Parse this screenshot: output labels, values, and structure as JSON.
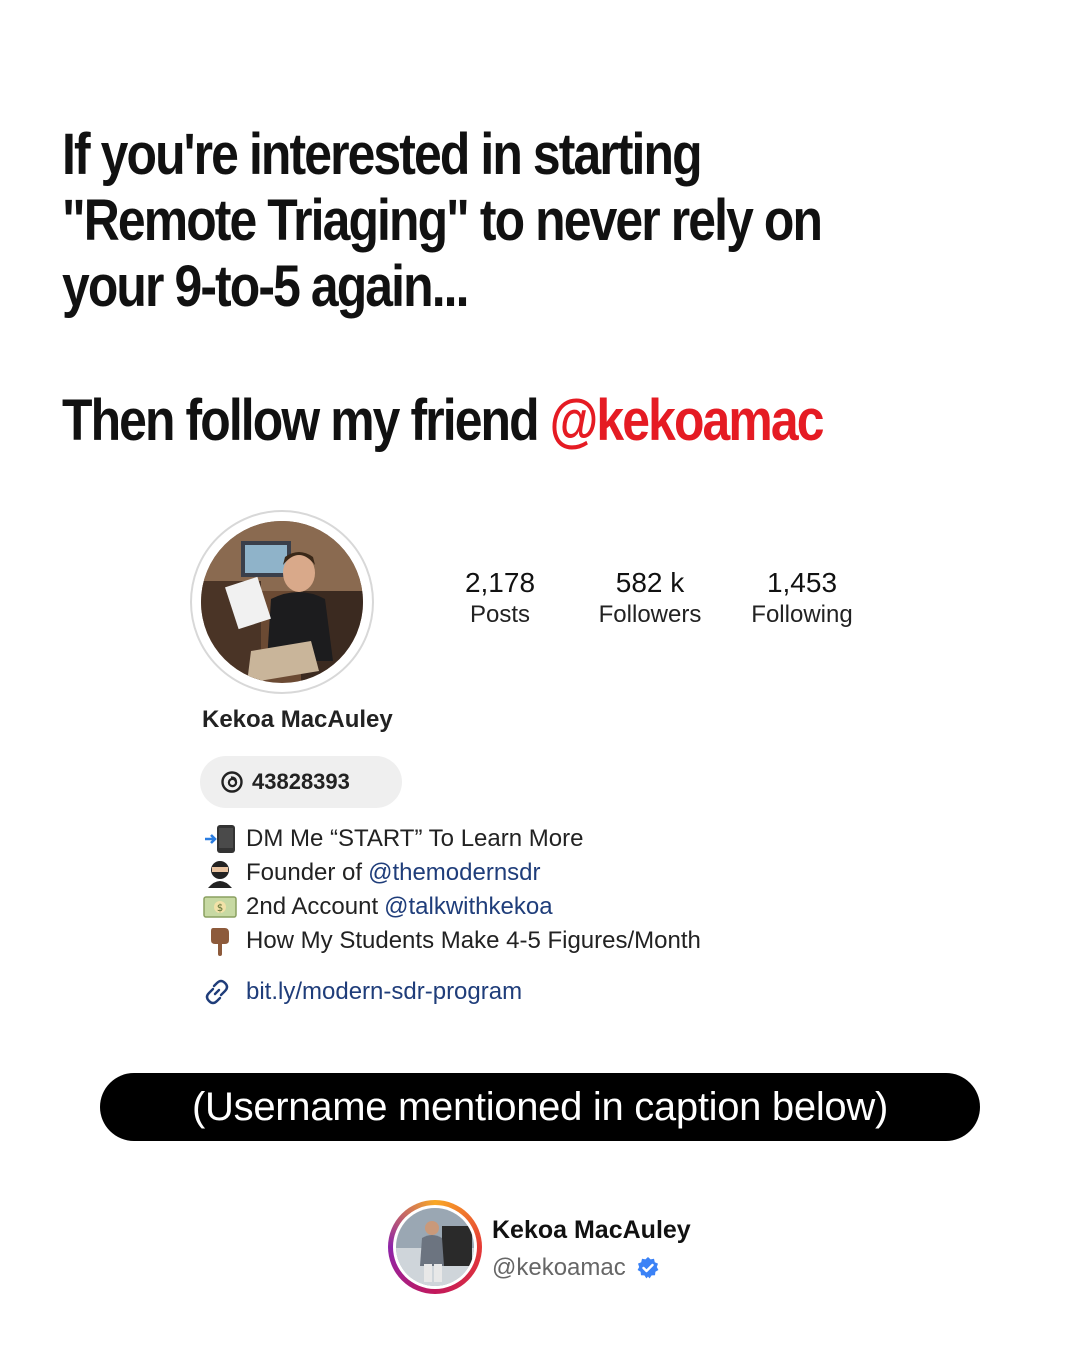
{
  "headline": {
    "line1": "If you're interested in starting",
    "line2": "\"Remote Triaging\" to never rely on",
    "line3": "your 9-to-5 again...",
    "follow_text": "Then follow my friend ",
    "follow_handle": "@kekoamac",
    "accent_color": "#e51b23"
  },
  "profile": {
    "stats": [
      {
        "value": "2,178",
        "label": "Posts"
      },
      {
        "value": "582 k",
        "label": "Followers"
      },
      {
        "value": "1,453",
        "label": "Following"
      }
    ],
    "name": "Kekoa MacAuley",
    "threads_badge": "43828393",
    "bio": [
      {
        "icon": "mobile-arrow-icon",
        "text": "DM Me “START” To Learn More",
        "link": ""
      },
      {
        "icon": "ninja-icon",
        "text": "Founder of",
        "link": "@themodernsdr"
      },
      {
        "icon": "money-icon",
        "text": "2nd Account",
        "link": "@talkwithkekoa"
      },
      {
        "icon": "pointing-down-icon",
        "text": "How My Students Make 4-5 Figures/Month",
        "link": ""
      }
    ],
    "website": "bit.ly/modern-sdr-program",
    "link_color": "#1f3d7a"
  },
  "caption_note": "(Username mentioned in caption below)",
  "footer": {
    "name": "Kekoa MacAuley",
    "handle": "@kekoamac"
  }
}
